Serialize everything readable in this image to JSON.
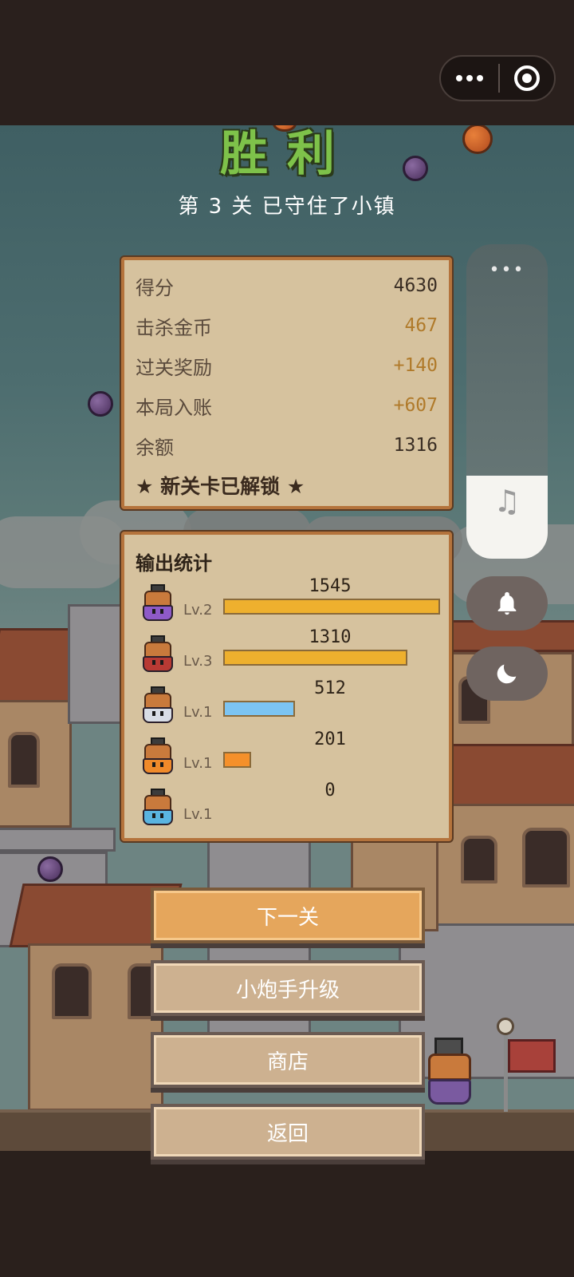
{
  "top_bar": {
    "menu_icon": "more-dots-icon",
    "close_icon": "target-circle-icon"
  },
  "result": {
    "title": "胜利",
    "subtitle": "第 3 关 已守住了小镇"
  },
  "stats": {
    "rows": [
      {
        "label": "得分",
        "value": "4630",
        "color": "#3a2e24"
      },
      {
        "label": "击杀金币",
        "value": "467",
        "color": "#b07a2a"
      },
      {
        "label": "过关奖励",
        "value": "+140",
        "color": "#b07a2a"
      },
      {
        "label": "本局入账",
        "value": "+607",
        "color": "#b07a2a"
      },
      {
        "label": "余额",
        "value": "1316",
        "color": "#3a2e24"
      }
    ],
    "unlock_text": "★ 新关卡已解锁 ★"
  },
  "output": {
    "title": "输出统计",
    "max_value": 1545,
    "rows": [
      {
        "value": 1545,
        "level": "Lv.2",
        "bar_color": "#eeb02e",
        "helm_color": "#c97a3c",
        "body_color": "#8e5ac8"
      },
      {
        "value": 1310,
        "level": "Lv.3",
        "bar_color": "#eeb02e",
        "helm_color": "#c97a3c",
        "body_color": "#b83a34"
      },
      {
        "value": 512,
        "level": "Lv.1",
        "bar_color": "#7cc4f2",
        "helm_color": "#c97a3c",
        "body_color": "#d8dde6"
      },
      {
        "value": 201,
        "level": "Lv.1",
        "bar_color": "#f5902a",
        "helm_color": "#c97a3c",
        "body_color": "#f08a2a"
      },
      {
        "value": 0,
        "level": "Lv.1",
        "bar_color": "#7cc4f2",
        "helm_color": "#c97a3c",
        "body_color": "#5ab4e0"
      }
    ]
  },
  "buttons": {
    "next_level": "下一关",
    "upgrade": "小炮手升级",
    "shop": "商店",
    "back": "返回"
  },
  "side_panel": {
    "more": "•••",
    "music_icon": "music-note-icon",
    "bell_icon": "bell-icon",
    "moon_icon": "moon-icon"
  }
}
